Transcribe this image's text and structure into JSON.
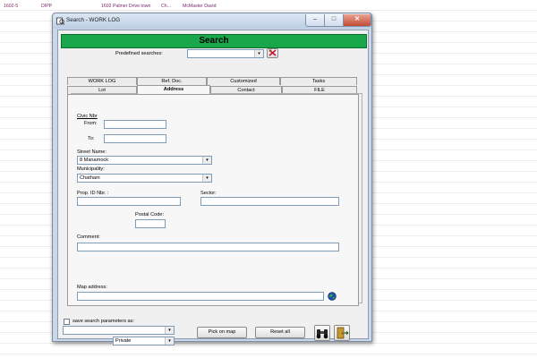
{
  "background_sheet": {
    "row": [
      "1602-5",
      "DIPP",
      "1602 Palmer Drive town",
      "Ch...",
      "McMaster David"
    ]
  },
  "window": {
    "title": "Search - WORK LOG",
    "controls": {
      "minimize": "–",
      "maximize": "□",
      "close": "✕"
    }
  },
  "header": {
    "title": "Search"
  },
  "predefined": {
    "label": "Predefined searches:",
    "value": "",
    "arrow": "▾"
  },
  "tabs_back": [
    "WORK LOG",
    "Ref. Doc.",
    "Customized",
    "Tasks"
  ],
  "tabs_front": [
    "Lot",
    "Address",
    "Contact",
    "FILE"
  ],
  "active_tab": "Address",
  "form": {
    "civic_label": "Civic Nbr",
    "from_label": "From:",
    "from_value": "",
    "to_label": "To:",
    "to_value": "",
    "street_label": "Street Name:",
    "street_value": "8 Manamock",
    "municipality_label": "Municipality:",
    "municipality_value": "Chatham",
    "prop_label": "Prop. ID Nbr. :",
    "prop_value": "",
    "sector_label": "Sector:",
    "sector_value": "",
    "postal_label": "Postal Code:",
    "postal_value": "",
    "comment_label": "Comment:",
    "comment_value": "",
    "map_label": "Map address:",
    "map_value": ""
  },
  "footer": {
    "save_label": "save search parameters as:",
    "save_name_value": "",
    "visibility_value": "Private",
    "pick_on_map": "Pick on map",
    "reset_all": "Reset all"
  },
  "colors": {
    "header_green": "#1aa64a",
    "window_frame": "#c9d7e8",
    "close_red": "#c24a34"
  }
}
